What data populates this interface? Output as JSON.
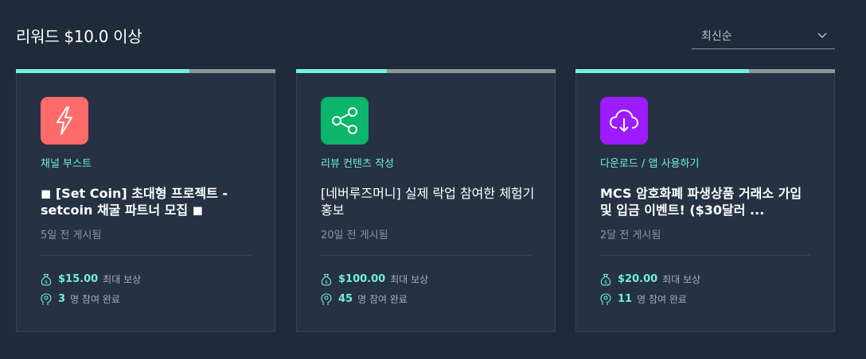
{
  "header": {
    "title": "리워드 $10.0 이상",
    "sort": {
      "selected": "최신순"
    }
  },
  "cards": [
    {
      "category": "채널 부스트",
      "title": "◼ [Set Coin] 초대형 프로젝트 - setcoin 채굴 파트너 모집 ◼",
      "posted": "5일 전 게시됨",
      "reward_value": "$15.00",
      "reward_label": "최대 보상",
      "participants_value": "3",
      "participants_label": "명 참여 완료",
      "progress": 0.67,
      "icon": "lightning-icon",
      "icon_bg": "#ff6b6b"
    },
    {
      "category": "리뷰 컨텐츠 작성",
      "title": "[네버루즈머니] 실제 락업 참여한 체험기 홍보",
      "posted": "20일 전 게시됨",
      "reward_value": "$100.00",
      "reward_label": "최대 보상",
      "participants_value": "45",
      "participants_label": "명 참여 완료",
      "progress": 0.35,
      "icon": "share-icon",
      "icon_bg": "#0bb56b"
    },
    {
      "category": "다운로드 / 앱 사용하기",
      "title": "MCS 암호화폐 파생상품 거래소 가입 및 입금 이벤트! ($30달러 ...",
      "posted": "2달 전 게시됨",
      "reward_value": "$20.00",
      "reward_label": "최대 보상",
      "participants_value": "11",
      "participants_label": "명 참여 완료",
      "progress": 0.67,
      "icon": "cloud-download-icon",
      "icon_bg": "#9b1cff"
    }
  ],
  "colors": {
    "background": "#1f2a3a",
    "card": "#263244",
    "accent": "#6df0d8",
    "progress_track": "#8f9497"
  }
}
